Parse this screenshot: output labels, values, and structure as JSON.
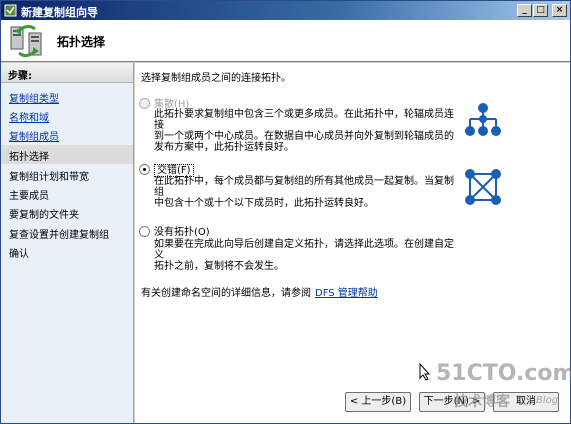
{
  "window": {
    "title": "新建复制组向导",
    "min_glyph": "_",
    "max_glyph": "□",
    "close_glyph": "×"
  },
  "header": {
    "title": "拓扑选择"
  },
  "nav": {
    "heading": "步骤:",
    "items": [
      {
        "label": "复制组类型",
        "state": "done"
      },
      {
        "label": "名称和域",
        "state": "done"
      },
      {
        "label": "复制组成员",
        "state": "done"
      },
      {
        "label": "拓扑选择",
        "state": "current"
      },
      {
        "label": "复制组计划和带宽",
        "state": "todo"
      },
      {
        "label": "主要成员",
        "state": "todo"
      },
      {
        "label": "要复制的文件夹",
        "state": "todo"
      },
      {
        "label": "复查设置并创建复制组",
        "state": "todo"
      },
      {
        "label": "确认",
        "state": "todo"
      }
    ]
  },
  "content": {
    "intro": "选择复制组成员之间的连接拓扑。",
    "options": [
      {
        "label": "集散(H)",
        "selected": false,
        "enabled": false,
        "desc_lines": [
          "此拓扑要求复制组中包含三个或更多成员。在此拓扑中，轮辐成员连接",
          "到一个或两个中心成员。在数据自中心成员并向外复制到轮辐成员的",
          "发布方案中，此拓扑运转良好。"
        ],
        "icon": "hub-spoke-icon"
      },
      {
        "label": "交错(F)",
        "selected": true,
        "enabled": true,
        "desc_lines": [
          "在此拓扑中，每个成员都与复制组的所有其他成员一起复制。当复制组",
          "中包含十个或十个以下成员时，此拓扑运转良好。"
        ],
        "icon": "full-mesh-icon"
      },
      {
        "label": "没有拓扑(O)",
        "selected": false,
        "enabled": true,
        "desc_lines": [
          "如果要在完成此向导后创建自定义拓扑，请选择此选项。在创建自定义",
          "拓扑之前，复制将不会发生。"
        ]
      }
    ],
    "help_text": "有关创建命名空间的详细信息，请参阅",
    "help_link": "DFS 管理帮助"
  },
  "buttons": {
    "back": "< 上一步(B)",
    "next": "下一步(N) >",
    "cancel": "取消"
  },
  "watermark": {
    "big": "51CTO.com",
    "small": "技术博客",
    "blog": "Blog"
  },
  "colors": {
    "title_bar": "#0a246a",
    "link": "#0033aa",
    "icon_blue": "#1a5fb4"
  }
}
